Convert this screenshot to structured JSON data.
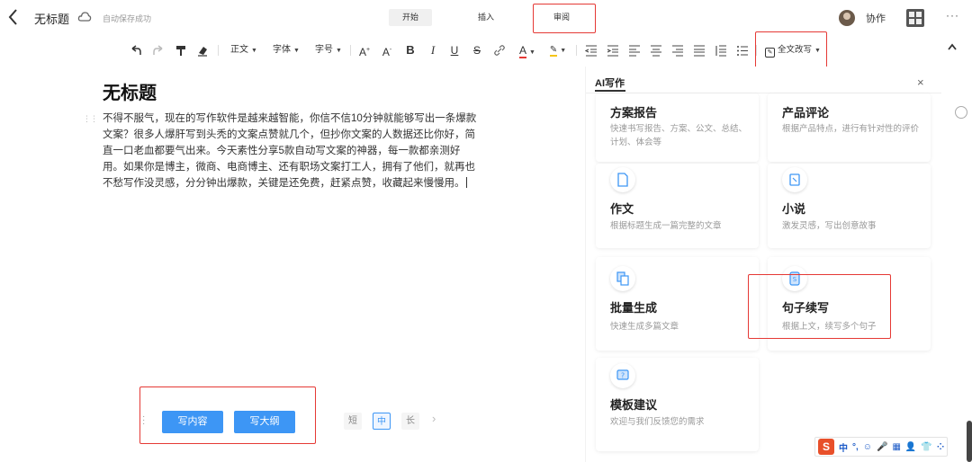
{
  "topbar": {
    "doc_title": "无标题",
    "save_status": "自动保存成功",
    "tabs": [
      {
        "label": "开始",
        "active": true
      },
      {
        "label": "插入",
        "active": false
      },
      {
        "label": "审阅",
        "active": false
      }
    ],
    "collab_label": "协作",
    "more_label": "···"
  },
  "toolbar": {
    "style_label": "正文",
    "font_label": "字体",
    "size_label": "字号",
    "full_write_label": "全文改写",
    "accent_color": "#e53935"
  },
  "editor": {
    "title": "无标题",
    "body": "不得不服气，现在的写作软件是越来越智能，你信不信10分钟就能够写出一条爆款文案？很多人爆肝写到头秃的文案点赞就几个，但抄你文案的人数据还比你好，简直一口老血都要气出来。今天素性分享5款自动写文案的神器，每一款都亲测好用。如果你是博主，微商、电商博主、还有职场文案打工人，拥有了他们，就再也不愁写作没灵感，分分钟出爆款，关键是还免费，赶紧点赞，收藏起来慢慢用。"
  },
  "writebar": {
    "write_content_label": "写内容",
    "write_outline_label": "写大纲",
    "length_options": [
      "短",
      "中",
      "长"
    ],
    "selected_length": "中",
    "button_color": "#3d96f5"
  },
  "ai_panel": {
    "title": "AI写作",
    "close_label": "×",
    "cards": [
      {
        "title": "方案报告",
        "desc": "快速书写报告、方案、公文、总结、计划、体会等",
        "icon": "report-icon"
      },
      {
        "title": "产品评论",
        "desc": "根据产品特点，进行有针对性的评价",
        "icon": "review-icon"
      },
      {
        "title": "作文",
        "desc": "根据标题生成一篇完整的文章",
        "icon": "document-icon"
      },
      {
        "title": "小说",
        "desc": "激发灵感，写出创意故事",
        "icon": "book-icon"
      },
      {
        "title": "批量生成",
        "desc": "快速生成多篇文章",
        "icon": "copy-icon"
      },
      {
        "title": "句子续写",
        "desc": "根据上文，续写多个句子",
        "icon": "sentence-icon"
      },
      {
        "title": "模板建议",
        "desc": "欢迎与我们反馈您的需求",
        "icon": "feedback-icon"
      }
    ]
  },
  "ime": {
    "logo": "S",
    "items": [
      "中",
      "°,",
      "☺",
      "🎤",
      "▦",
      "👤",
      "👕",
      "⁘"
    ]
  }
}
